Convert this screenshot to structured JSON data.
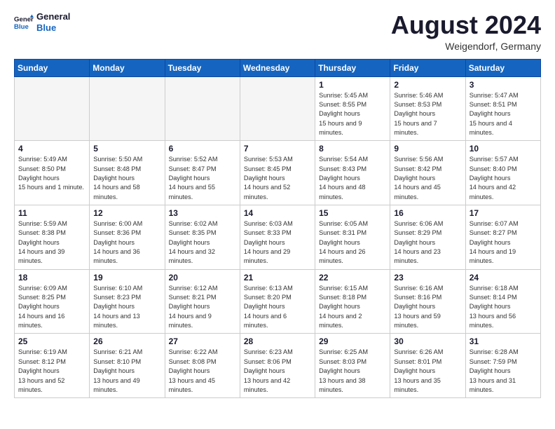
{
  "logo": {
    "general": "General",
    "blue": "Blue"
  },
  "header": {
    "title": "August 2024",
    "subtitle": "Weigendorf, Germany"
  },
  "weekdays": [
    "Sunday",
    "Monday",
    "Tuesday",
    "Wednesday",
    "Thursday",
    "Friday",
    "Saturday"
  ],
  "weeks": [
    [
      {
        "day": "",
        "empty": true
      },
      {
        "day": "",
        "empty": true
      },
      {
        "day": "",
        "empty": true
      },
      {
        "day": "",
        "empty": true
      },
      {
        "day": "1",
        "sunrise": "5:45 AM",
        "sunset": "8:55 PM",
        "daylight": "15 hours and 9 minutes."
      },
      {
        "day": "2",
        "sunrise": "5:46 AM",
        "sunset": "8:53 PM",
        "daylight": "15 hours and 7 minutes."
      },
      {
        "day": "3",
        "sunrise": "5:47 AM",
        "sunset": "8:51 PM",
        "daylight": "15 hours and 4 minutes."
      }
    ],
    [
      {
        "day": "4",
        "sunrise": "5:49 AM",
        "sunset": "8:50 PM",
        "daylight": "15 hours and 1 minute."
      },
      {
        "day": "5",
        "sunrise": "5:50 AM",
        "sunset": "8:48 PM",
        "daylight": "14 hours and 58 minutes."
      },
      {
        "day": "6",
        "sunrise": "5:52 AM",
        "sunset": "8:47 PM",
        "daylight": "14 hours and 55 minutes."
      },
      {
        "day": "7",
        "sunrise": "5:53 AM",
        "sunset": "8:45 PM",
        "daylight": "14 hours and 52 minutes."
      },
      {
        "day": "8",
        "sunrise": "5:54 AM",
        "sunset": "8:43 PM",
        "daylight": "14 hours and 48 minutes."
      },
      {
        "day": "9",
        "sunrise": "5:56 AM",
        "sunset": "8:42 PM",
        "daylight": "14 hours and 45 minutes."
      },
      {
        "day": "10",
        "sunrise": "5:57 AM",
        "sunset": "8:40 PM",
        "daylight": "14 hours and 42 minutes."
      }
    ],
    [
      {
        "day": "11",
        "sunrise": "5:59 AM",
        "sunset": "8:38 PM",
        "daylight": "14 hours and 39 minutes."
      },
      {
        "day": "12",
        "sunrise": "6:00 AM",
        "sunset": "8:36 PM",
        "daylight": "14 hours and 36 minutes."
      },
      {
        "day": "13",
        "sunrise": "6:02 AM",
        "sunset": "8:35 PM",
        "daylight": "14 hours and 32 minutes."
      },
      {
        "day": "14",
        "sunrise": "6:03 AM",
        "sunset": "8:33 PM",
        "daylight": "14 hours and 29 minutes."
      },
      {
        "day": "15",
        "sunrise": "6:05 AM",
        "sunset": "8:31 PM",
        "daylight": "14 hours and 26 minutes."
      },
      {
        "day": "16",
        "sunrise": "6:06 AM",
        "sunset": "8:29 PM",
        "daylight": "14 hours and 23 minutes."
      },
      {
        "day": "17",
        "sunrise": "6:07 AM",
        "sunset": "8:27 PM",
        "daylight": "14 hours and 19 minutes."
      }
    ],
    [
      {
        "day": "18",
        "sunrise": "6:09 AM",
        "sunset": "8:25 PM",
        "daylight": "14 hours and 16 minutes."
      },
      {
        "day": "19",
        "sunrise": "6:10 AM",
        "sunset": "8:23 PM",
        "daylight": "14 hours and 13 minutes."
      },
      {
        "day": "20",
        "sunrise": "6:12 AM",
        "sunset": "8:21 PM",
        "daylight": "14 hours and 9 minutes."
      },
      {
        "day": "21",
        "sunrise": "6:13 AM",
        "sunset": "8:20 PM",
        "daylight": "14 hours and 6 minutes."
      },
      {
        "day": "22",
        "sunrise": "6:15 AM",
        "sunset": "8:18 PM",
        "daylight": "14 hours and 2 minutes."
      },
      {
        "day": "23",
        "sunrise": "6:16 AM",
        "sunset": "8:16 PM",
        "daylight": "13 hours and 59 minutes."
      },
      {
        "day": "24",
        "sunrise": "6:18 AM",
        "sunset": "8:14 PM",
        "daylight": "13 hours and 56 minutes."
      }
    ],
    [
      {
        "day": "25",
        "sunrise": "6:19 AM",
        "sunset": "8:12 PM",
        "daylight": "13 hours and 52 minutes."
      },
      {
        "day": "26",
        "sunrise": "6:21 AM",
        "sunset": "8:10 PM",
        "daylight": "13 hours and 49 minutes."
      },
      {
        "day": "27",
        "sunrise": "6:22 AM",
        "sunset": "8:08 PM",
        "daylight": "13 hours and 45 minutes."
      },
      {
        "day": "28",
        "sunrise": "6:23 AM",
        "sunset": "8:06 PM",
        "daylight": "13 hours and 42 minutes."
      },
      {
        "day": "29",
        "sunrise": "6:25 AM",
        "sunset": "8:03 PM",
        "daylight": "13 hours and 38 minutes."
      },
      {
        "day": "30",
        "sunrise": "6:26 AM",
        "sunset": "8:01 PM",
        "daylight": "13 hours and 35 minutes."
      },
      {
        "day": "31",
        "sunrise": "6:28 AM",
        "sunset": "7:59 PM",
        "daylight": "13 hours and 31 minutes."
      }
    ]
  ],
  "labels": {
    "sunrise": "Sunrise:",
    "sunset": "Sunset:",
    "daylight": "Daylight hours"
  }
}
